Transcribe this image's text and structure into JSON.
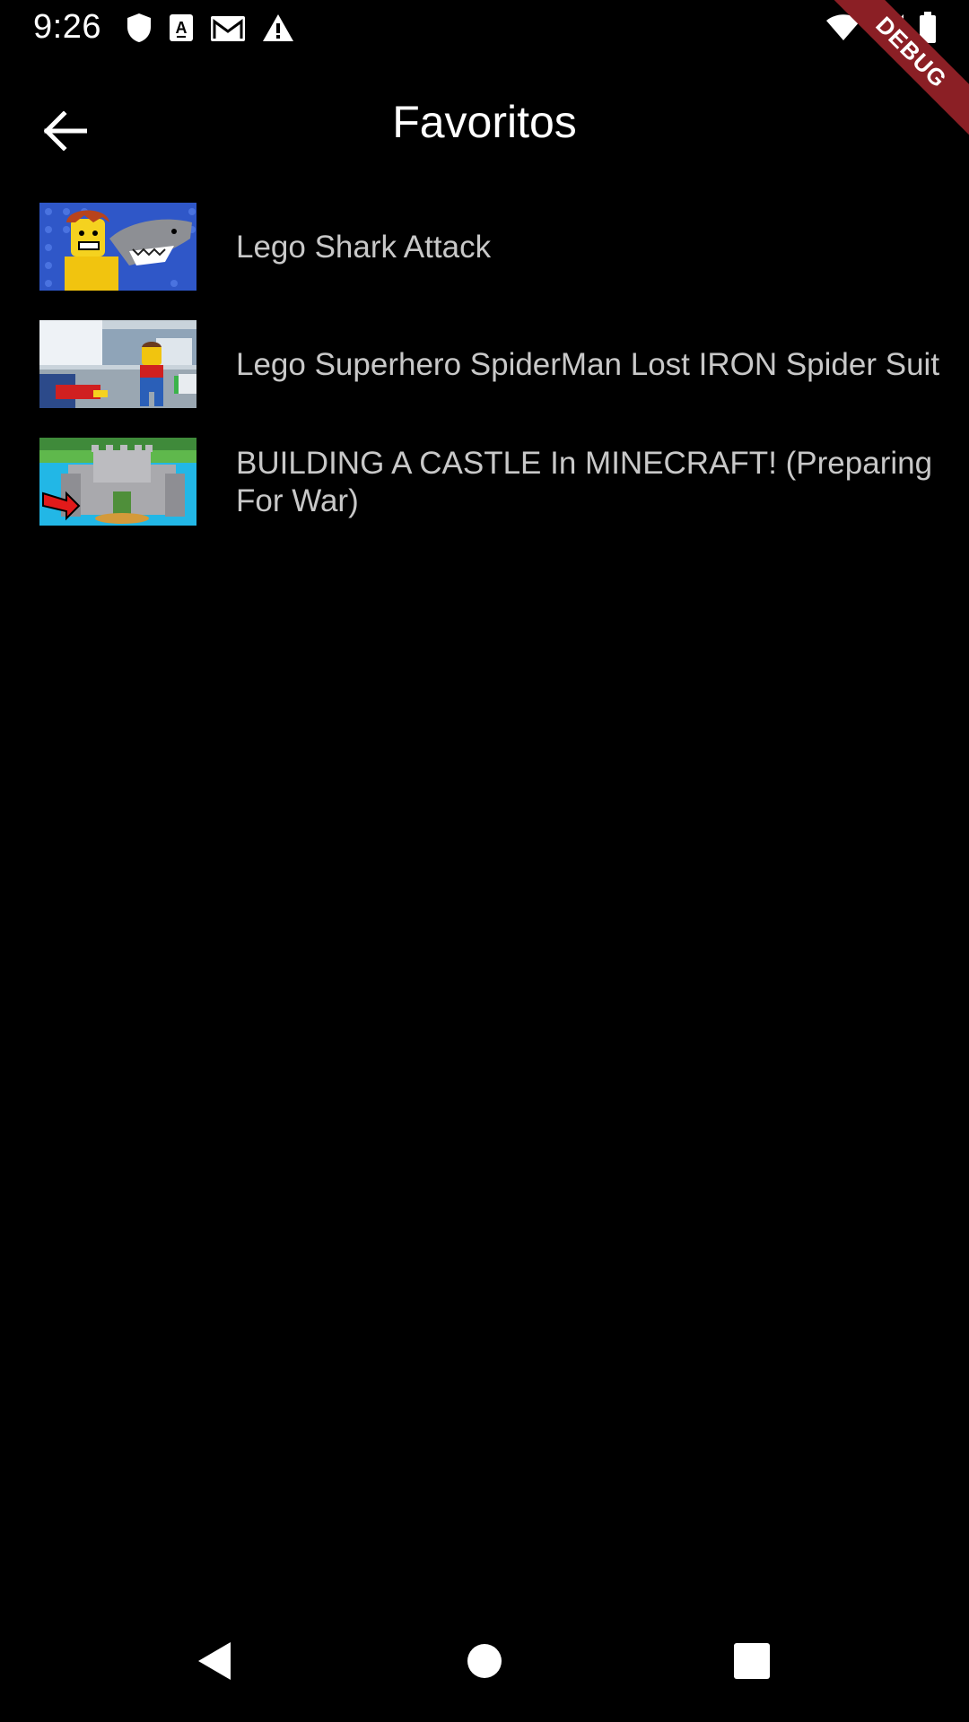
{
  "status_bar": {
    "time": "9:26",
    "left_icons": [
      "shield-icon",
      "font-a-icon",
      "gmail-icon",
      "warning-icon"
    ],
    "right_icons": [
      "wifi-icon",
      "signal-icon",
      "battery-icon"
    ]
  },
  "debug_banner": {
    "label": "DEBUG",
    "color": "#8b1f25"
  },
  "app_bar": {
    "title": "Favoritos",
    "back_icon": "arrow-left-icon"
  },
  "favorites": [
    {
      "title": "Lego Shark Attack",
      "thumbnail": "lego-shark-thumbnail"
    },
    {
      "title": "Lego Superhero SpiderMan Lost IRON Spider Suit",
      "thumbnail": "lego-spiderman-thumbnail"
    },
    {
      "title": "BUILDING A CASTLE In MINECRAFT! (Preparing For War)",
      "thumbnail": "minecraft-castle-thumbnail"
    }
  ],
  "nav_bar": {
    "back_icon": "nav-back-icon",
    "home_icon": "nav-home-icon",
    "recents_icon": "nav-recents-icon"
  },
  "colors": {
    "background": "#000000",
    "title_text": "#ffffff",
    "item_text": "#c8c8c8",
    "nav_icons": "#ffffff"
  }
}
